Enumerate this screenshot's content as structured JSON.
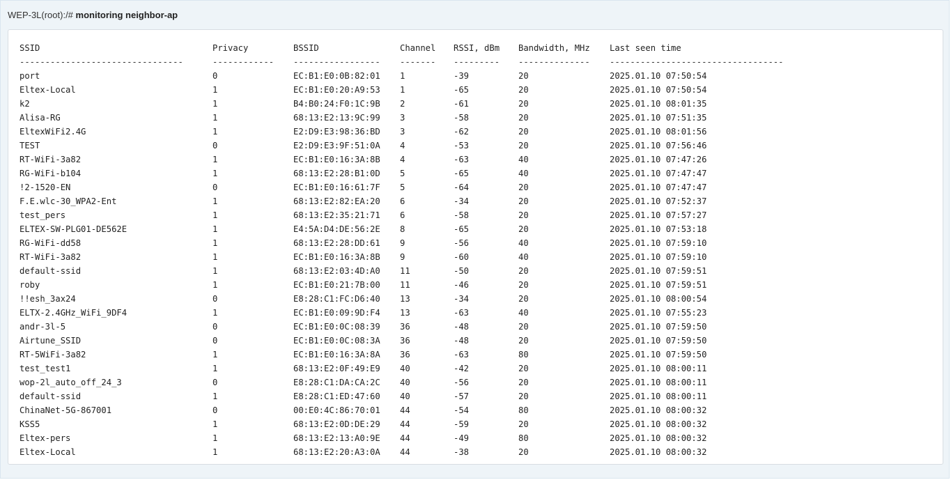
{
  "prompt": {
    "text": "WEP-3L(root):/# ",
    "command": "monitoring neighbor-ap"
  },
  "table": {
    "headers": [
      "SSID",
      "Privacy",
      "BSSID",
      "Channel",
      "RSSI, dBm",
      "Bandwidth, MHz",
      "Last seen time"
    ],
    "separators": [
      "--------------------------------",
      "------------",
      "-----------------",
      "-------",
      "---------",
      "--------------",
      "----------------------------------"
    ],
    "rows": [
      [
        "port",
        "0",
        "EC:B1:E0:0B:82:01",
        "1",
        "-39",
        "20",
        "2025.01.10 07:50:54"
      ],
      [
        "Eltex-Local",
        "1",
        "EC:B1:E0:20:A9:53",
        "1",
        "-65",
        "20",
        "2025.01.10 07:50:54"
      ],
      [
        "k2",
        "1",
        "B4:B0:24:F0:1C:9B",
        "2",
        "-61",
        "20",
        "2025.01.10 08:01:35"
      ],
      [
        "Alisa-RG",
        "1",
        "68:13:E2:13:9C:99",
        "3",
        "-58",
        "20",
        "2025.01.10 07:51:35"
      ],
      [
        "EltexWiFi2.4G",
        "1",
        "E2:D9:E3:98:36:BD",
        "3",
        "-62",
        "20",
        "2025.01.10 08:01:56"
      ],
      [
        "TEST",
        "0",
        "E2:D9:E3:9F:51:0A",
        "4",
        "-53",
        "20",
        "2025.01.10 07:56:46"
      ],
      [
        "RT-WiFi-3a82",
        "1",
        "EC:B1:E0:16:3A:8B",
        "4",
        "-63",
        "40",
        "2025.01.10 07:47:26"
      ],
      [
        "RG-WiFi-b104",
        "1",
        "68:13:E2:28:B1:0D",
        "5",
        "-65",
        "40",
        "2025.01.10 07:47:47"
      ],
      [
        "!2-1520-EN",
        "0",
        "EC:B1:E0:16:61:7F",
        "5",
        "-64",
        "20",
        "2025.01.10 07:47:47"
      ],
      [
        "F.E.wlc-30_WPA2-Ent",
        "1",
        "68:13:E2:82:EA:20",
        "6",
        "-34",
        "20",
        "2025.01.10 07:52:37"
      ],
      [
        "test_pers",
        "1",
        "68:13:E2:35:21:71",
        "6",
        "-58",
        "20",
        "2025.01.10 07:57:27"
      ],
      [
        "ELTEX-SW-PLG01-DE562E",
        "1",
        "E4:5A:D4:DE:56:2E",
        "8",
        "-65",
        "20",
        "2025.01.10 07:53:18"
      ],
      [
        "RG-WiFi-dd58",
        "1",
        "68:13:E2:28:DD:61",
        "9",
        "-56",
        "40",
        "2025.01.10 07:59:10"
      ],
      [
        "RT-WiFi-3a82",
        "1",
        "EC:B1:E0:16:3A:8B",
        "9",
        "-60",
        "40",
        "2025.01.10 07:59:10"
      ],
      [
        "default-ssid",
        "1",
        "68:13:E2:03:4D:A0",
        "11",
        "-50",
        "20",
        "2025.01.10 07:59:51"
      ],
      [
        "roby",
        "1",
        "EC:B1:E0:21:7B:00",
        "11",
        "-46",
        "20",
        "2025.01.10 07:59:51"
      ],
      [
        "!!esh_3ax24",
        "0",
        "E8:28:C1:FC:D6:40",
        "13",
        "-34",
        "20",
        "2025.01.10 08:00:54"
      ],
      [
        "ELTX-2.4GHz_WiFi_9DF4",
        "1",
        "EC:B1:E0:09:9D:F4",
        "13",
        "-63",
        "40",
        "2025.01.10 07:55:23"
      ],
      [
        "andr-3l-5",
        "0",
        "EC:B1:E0:0C:08:39",
        "36",
        "-48",
        "20",
        "2025.01.10 07:59:50"
      ],
      [
        "Airtune_SSID",
        "0",
        "EC:B1:E0:0C:08:3A",
        "36",
        "-48",
        "20",
        "2025.01.10 07:59:50"
      ],
      [
        "RT-5WiFi-3a82",
        "1",
        "EC:B1:E0:16:3A:8A",
        "36",
        "-63",
        "80",
        "2025.01.10 07:59:50"
      ],
      [
        "test_test1",
        "1",
        "68:13:E2:0F:49:E9",
        "40",
        "-42",
        "20",
        "2025.01.10 08:00:11"
      ],
      [
        "wop-2l_auto_off_24_3",
        "0",
        "E8:28:C1:DA:CA:2C",
        "40",
        "-56",
        "20",
        "2025.01.10 08:00:11"
      ],
      [
        "default-ssid",
        "1",
        "E8:28:C1:ED:47:60",
        "40",
        "-57",
        "20",
        "2025.01.10 08:00:11"
      ],
      [
        "ChinaNet-5G-867001",
        "0",
        "00:E0:4C:86:70:01",
        "44",
        "-54",
        "80",
        "2025.01.10 08:00:32"
      ],
      [
        "KSS5",
        "1",
        "68:13:E2:0D:DE:29",
        "44",
        "-59",
        "20",
        "2025.01.10 08:00:32"
      ],
      [
        "Eltex-pers",
        "1",
        "68:13:E2:13:A0:9E",
        "44",
        "-49",
        "80",
        "2025.01.10 08:00:32"
      ],
      [
        "Eltex-Local",
        "1",
        "68:13:E2:20:A3:0A",
        "44",
        "-38",
        "20",
        "2025.01.10 08:00:32"
      ]
    ]
  }
}
